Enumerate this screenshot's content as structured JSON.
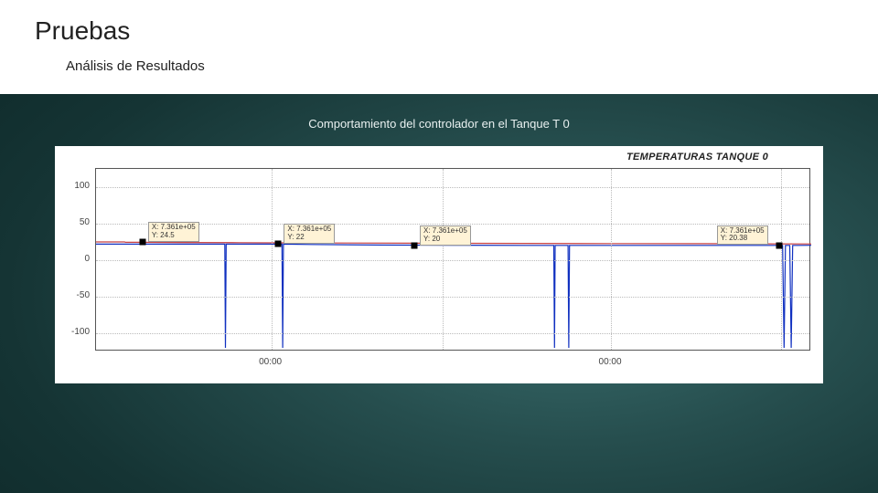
{
  "accent_color": "#b22a2a",
  "title": "Pruebas",
  "subtitle": "Análisis de Resultados",
  "caption": "Comportamiento del controlador en el Tanque T 0",
  "chart_data": {
    "type": "line",
    "title": "TEMPERATURAS TANQUE 0",
    "xlabel": "",
    "ylabel": "",
    "ylim": [
      -125,
      125
    ],
    "yticks": [
      -100,
      -50,
      0,
      50,
      100
    ],
    "xtick_labels": [
      "00:00",
      "00:00"
    ],
    "xtick_positions": [
      0.245,
      0.72
    ],
    "grid_v_positions": [
      0.245,
      0.485,
      0.72,
      0.958
    ],
    "series": [
      {
        "name": "red",
        "color": "#c84040",
        "x": [
          0.0,
          0.04,
          0.041,
          0.06,
          0.12,
          0.2,
          0.3,
          0.45,
          0.6,
          0.72,
          0.85,
          0.95,
          1.0
        ],
        "y": [
          25,
          25,
          24.5,
          24.5,
          24.3,
          24.0,
          23.6,
          23.2,
          23.0,
          22.8,
          22.6,
          22.4,
          22.3
        ]
      },
      {
        "name": "blue",
        "color": "#1030c0",
        "x": [
          0.0,
          0.1,
          0.18,
          0.181,
          0.182,
          0.24,
          0.26,
          0.261,
          0.262,
          0.3,
          0.4,
          0.5,
          0.6,
          0.64,
          0.641,
          0.642,
          0.66,
          0.661,
          0.662,
          0.72,
          0.8,
          0.88,
          0.94,
          0.96,
          0.962,
          0.964,
          0.97,
          0.972,
          0.974,
          0.98,
          1.0
        ],
        "y": [
          22,
          22,
          22,
          -120,
          22,
          22,
          22,
          -120,
          22,
          21.5,
          20.8,
          20.5,
          20.3,
          20.2,
          -120,
          20.2,
          20.2,
          -120,
          20.2,
          20.2,
          20.2,
          20.2,
          20.3,
          20.3,
          -120,
          20.3,
          20.3,
          -120,
          20.3,
          20.3,
          20.38
        ]
      }
    ],
    "datatips": [
      {
        "x_frac": 0.065,
        "y": 24.5,
        "lines": [
          "X: 7.361e+05",
          "Y: 24.5"
        ]
      },
      {
        "x_frac": 0.255,
        "y": 22,
        "lines": [
          "X: 7.361e+05",
          "Y: 22"
        ]
      },
      {
        "x_frac": 0.445,
        "y": 20,
        "lines": [
          "X: 7.361e+05",
          "Y: 20"
        ]
      },
      {
        "x_frac": 0.955,
        "y": 20.38,
        "lines": [
          "X: 7.361e+05",
          "Y: 20.38"
        ]
      }
    ]
  }
}
